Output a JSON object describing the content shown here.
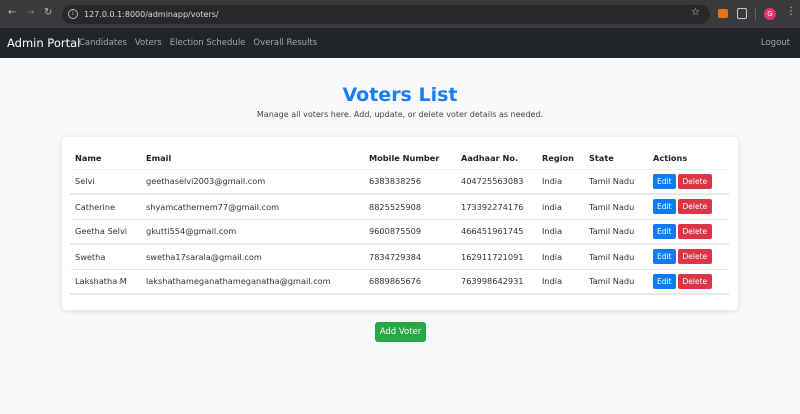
{
  "browser": {
    "url": "127.0.0.1:8000/adminapp/voters/",
    "profile_initial": "G"
  },
  "navbar": {
    "brand": "Admin Portal",
    "links": [
      "Candidates",
      "Voters",
      "Election Schedule",
      "Overall Results"
    ],
    "logout": "Logout"
  },
  "page": {
    "title": "Voters List",
    "subtitle": "Manage all voters here. Add, update, or delete voter details as needed."
  },
  "table": {
    "headers": [
      "Name",
      "Email",
      "Mobile Number",
      "Aadhaar No.",
      "Region",
      "State",
      "Actions"
    ],
    "rows": [
      {
        "name": "Selvi",
        "email": "geethaselvi2003@gmail.com",
        "mobile": "6383838256",
        "aadhaar": "404725563083",
        "region": "India",
        "state": "Tamil Nadu"
      },
      {
        "name": "Catherine",
        "email": "shyamcathernem77@gmail.com",
        "mobile": "8825525908",
        "aadhaar": "173392274176",
        "region": "india",
        "state": "Tamil Nadu"
      },
      {
        "name": "Geetha Selvi",
        "email": "gkutti554@gmail.com",
        "mobile": "9600875509",
        "aadhaar": "466451961745",
        "region": "India",
        "state": "Tamil Nadu"
      },
      {
        "name": "Swetha",
        "email": "swetha17sarala@gmail.com",
        "mobile": "7834729384",
        "aadhaar": "162911721091",
        "region": "India",
        "state": "Tamil Nadu"
      },
      {
        "name": "Lakshatha M",
        "email": "lakshathameganathameganatha@gmail.com",
        "mobile": "6889865676",
        "aadhaar": "763998642931",
        "region": "India",
        "state": "Tamil Nadu"
      }
    ],
    "edit_label": "Edit",
    "delete_label": "Delete"
  },
  "add_button": "Add Voter",
  "colors": {
    "primary": "#1a7ef7",
    "danger": "#dc3545",
    "success": "#28a745",
    "navbar": "#212529"
  }
}
